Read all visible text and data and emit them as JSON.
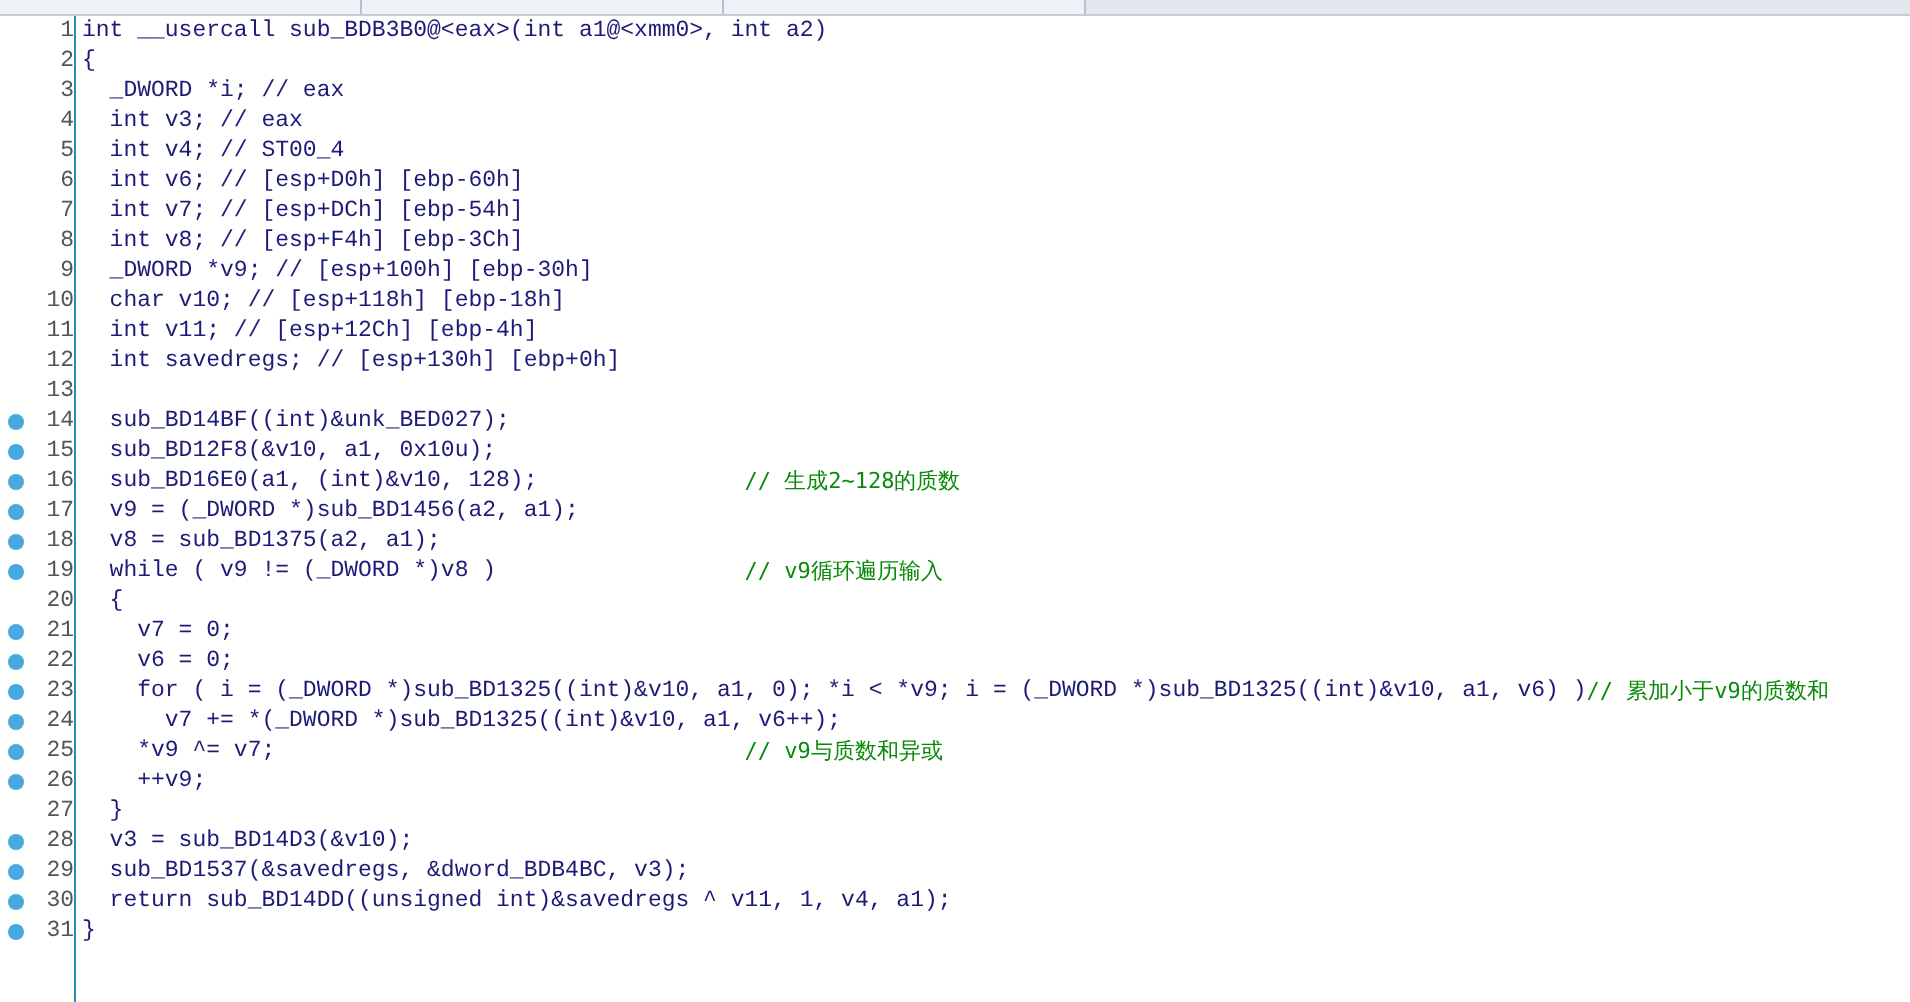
{
  "editor": {
    "lines": [
      {
        "number": "1",
        "code": "int __usercall sub_BDB3B0@<eax>(int a1@<xmm0>, int a2)",
        "breakpoint": false
      },
      {
        "number": "2",
        "code": "{",
        "breakpoint": false
      },
      {
        "number": "3",
        "code": "  _DWORD *i; // eax",
        "breakpoint": false
      },
      {
        "number": "4",
        "code": "  int v3; // eax",
        "breakpoint": false
      },
      {
        "number": "5",
        "code": "  int v4; // ST00_4",
        "breakpoint": false
      },
      {
        "number": "6",
        "code": "  int v6; // [esp+D0h] [ebp-60h]",
        "breakpoint": false
      },
      {
        "number": "7",
        "code": "  int v7; // [esp+DCh] [ebp-54h]",
        "breakpoint": false
      },
      {
        "number": "8",
        "code": "  int v8; // [esp+F4h] [ebp-3Ch]",
        "breakpoint": false
      },
      {
        "number": "9",
        "code": "  _DWORD *v9; // [esp+100h] [ebp-30h]",
        "breakpoint": false
      },
      {
        "number": "10",
        "code": "  char v10; // [esp+118h] [ebp-18h]",
        "breakpoint": false
      },
      {
        "number": "11",
        "code": "  int v11; // [esp+12Ch] [ebp-4h]",
        "breakpoint": false
      },
      {
        "number": "12",
        "code": "  int savedregs; // [esp+130h] [ebp+0h]",
        "breakpoint": false
      },
      {
        "number": "13",
        "breakpoint": false
      },
      {
        "number": "14",
        "code": "  sub_BD14BF((int)&unk_BED027);",
        "breakpoint": true
      },
      {
        "number": "15",
        "code": "  sub_BD12F8(&v10, a1, 0x10u);",
        "breakpoint": true
      },
      {
        "number": "16",
        "code": "  sub_BD16E0(a1, (int)&v10, 128);",
        "comment": "// 生成2~128的质数",
        "breakpoint": true
      },
      {
        "number": "17",
        "code": "  v9 = (_DWORD *)sub_BD1456(a2, a1);",
        "breakpoint": true
      },
      {
        "number": "18",
        "code": "  v8 = sub_BD1375(a2, a1);",
        "breakpoint": true
      },
      {
        "number": "19",
        "code": "  while ( v9 != (_DWORD *)v8 )",
        "comment": "// v9循环遍历输入",
        "breakpoint": true
      },
      {
        "number": "20",
        "code": "  {",
        "breakpoint": false
      },
      {
        "number": "21",
        "code": "    v7 = 0;",
        "breakpoint": true
      },
      {
        "number": "22",
        "code": "    v6 = 0;",
        "breakpoint": true
      },
      {
        "number": "23",
        "code": "    for ( i = (_DWORD *)sub_BD1325((int)&v10, a1, 0); *i < *v9; i = (_DWORD *)sub_BD1325((int)&v10, a1, v6) )",
        "comment": "// 累加小于v9的质数和",
        "breakpoint": true
      },
      {
        "number": "24",
        "code": "      v7 += *(_DWORD *)sub_BD1325((int)&v10, a1, v6++);",
        "breakpoint": true
      },
      {
        "number": "25",
        "code": "    *v9 ^= v7;",
        "comment": "// v9与质数和异或",
        "breakpoint": true
      },
      {
        "number": "26",
        "code": "    ++v9;",
        "breakpoint": true
      },
      {
        "number": "27",
        "code": "  }",
        "breakpoint": false
      },
      {
        "number": "28",
        "code": "  v3 = sub_BD14D3(&v10);",
        "breakpoint": true
      },
      {
        "number": "29",
        "code": "  sub_BD1537(&savedregs, &dword_BDB4BC, v3);",
        "breakpoint": true
      },
      {
        "number": "30",
        "code": "  return sub_BD14DD((unsigned int)&savedregs ^ v11, 1, v4, a1);",
        "breakpoint": true
      },
      {
        "number": "31",
        "code": "}",
        "breakpoint": true
      }
    ]
  }
}
